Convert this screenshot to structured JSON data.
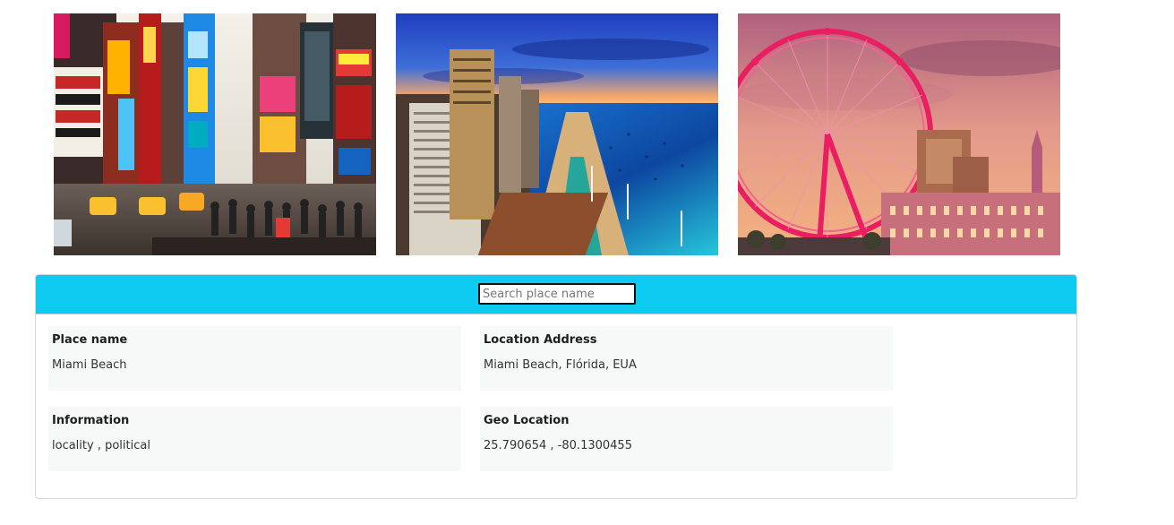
{
  "gallery": {
    "images": [
      {
        "name": "Times Square street scene"
      },
      {
        "name": "Coastal city beach skyline"
      },
      {
        "name": "London Eye at sunset"
      }
    ]
  },
  "search": {
    "placeholder": "Search place name",
    "value": ""
  },
  "details": {
    "place_name_label": "Place name",
    "place_name_value": "Miami Beach",
    "location_address_label": "Location Address",
    "location_address_value": "Miami Beach, Flórida, EUA",
    "information_label": "Information",
    "information_value": "locality , political",
    "geo_location_label": "Geo Location",
    "geo_location_value": "25.790654 , -80.1300455"
  },
  "colors": {
    "header_accent": "#0dcaf0",
    "box_background": "#f7f8f8"
  }
}
